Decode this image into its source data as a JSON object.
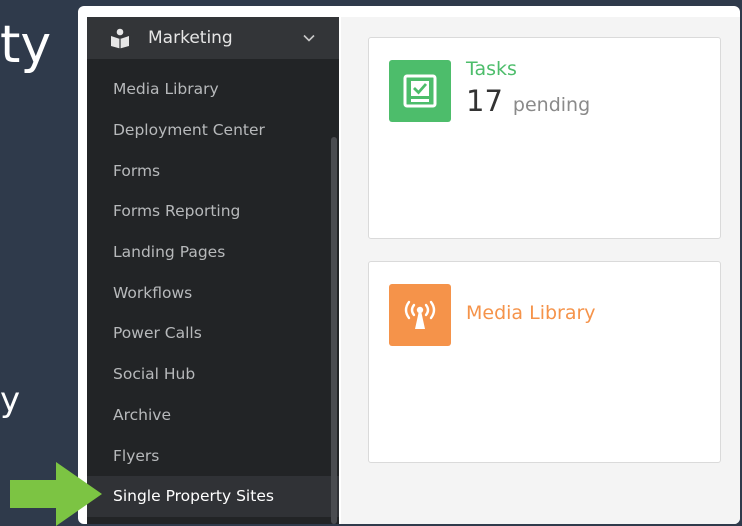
{
  "background": {
    "text_top": "ty",
    "text_bottom": "y"
  },
  "sidebar": {
    "header": {
      "label": "Marketing",
      "icon": "book-reader-icon"
    },
    "items": [
      {
        "label": "Media Library"
      },
      {
        "label": "Deployment Center"
      },
      {
        "label": "Forms"
      },
      {
        "label": "Forms Reporting"
      },
      {
        "label": "Landing Pages"
      },
      {
        "label": "Workflows"
      },
      {
        "label": "Power Calls"
      },
      {
        "label": "Social Hub"
      },
      {
        "label": "Archive"
      },
      {
        "label": "Flyers"
      },
      {
        "label": "Single Property Sites",
        "active": true
      }
    ]
  },
  "cards": {
    "tasks": {
      "title": "Tasks",
      "count": "17",
      "count_label": "pending",
      "icon": "checkbox-check-icon",
      "color": "#4dbd6b"
    },
    "media": {
      "title": "Media Library",
      "icon": "broadcast-antenna-icon",
      "color": "#f5934a"
    }
  },
  "colors": {
    "sidebar_bg": "#222426",
    "sidebar_active": "#303236",
    "arrow": "#7cc443"
  }
}
